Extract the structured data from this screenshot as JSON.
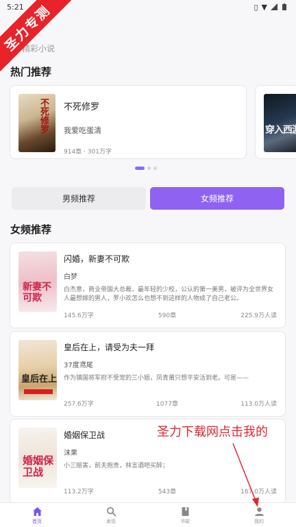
{
  "status_bar": {
    "time": "5:21"
  },
  "watermark": "圣力专测",
  "header": {
    "subtitle": "精彩小说"
  },
  "hot_section": {
    "title": "热门推荐",
    "cards": [
      {
        "title": "不死修罗",
        "author": "我爱吃蛋清",
        "meta": "914章 · 301万字",
        "cover_text": "不死修罗"
      },
      {
        "cover_text": "穿入西游"
      }
    ]
  },
  "tabs": {
    "male": "男频推荐",
    "female": "女频推荐",
    "selected": "female"
  },
  "list_section": {
    "title": "女频推荐",
    "books": [
      {
        "title": "闪婚，新妻不可欺",
        "author": "白梦",
        "desc": "白杰意，商业帝国大总裁，最年轻的少校，公认的第一美男，被评为全世界女人最想嫁的男人，罗小欢怎么也想不到这样的人物成了自己老公。",
        "words": "145.6万字",
        "chapters": "590章",
        "readers": "225.9万人读",
        "cover_text": "新妻不可欺"
      },
      {
        "title": "皇后在上，请受为夫一拜",
        "author": "37度鸢尾",
        "desc": "作为镇国将军府不受宠的三小姐，凤青莆只想平安活到老。可是——",
        "words": "257.6万字",
        "chapters": "1077章",
        "readers": "113.0万人读",
        "cover_text": "皇后在上"
      },
      {
        "title": "婚姻保卫战",
        "author": "沫果",
        "desc": "小三赔害，前夫抱责，林言酒吧买醉；",
        "words": "113.2万字",
        "chapters": "543章",
        "readers": "167.0万人读",
        "cover_text": "婚姻保卫战"
      }
    ]
  },
  "bottom_nav": [
    {
      "label": "首页",
      "icon": "home-icon",
      "active": true
    },
    {
      "label": "发现",
      "icon": "search-icon",
      "active": false
    },
    {
      "label": "书架",
      "icon": "book-icon",
      "active": false
    },
    {
      "label": "我的",
      "icon": "person-icon",
      "active": false
    }
  ],
  "annotation": "圣力下载网点击我的",
  "colors": {
    "accent": "#8f62f2",
    "annotation_red": "#e2262c",
    "watermark_red": "#e8232a"
  }
}
